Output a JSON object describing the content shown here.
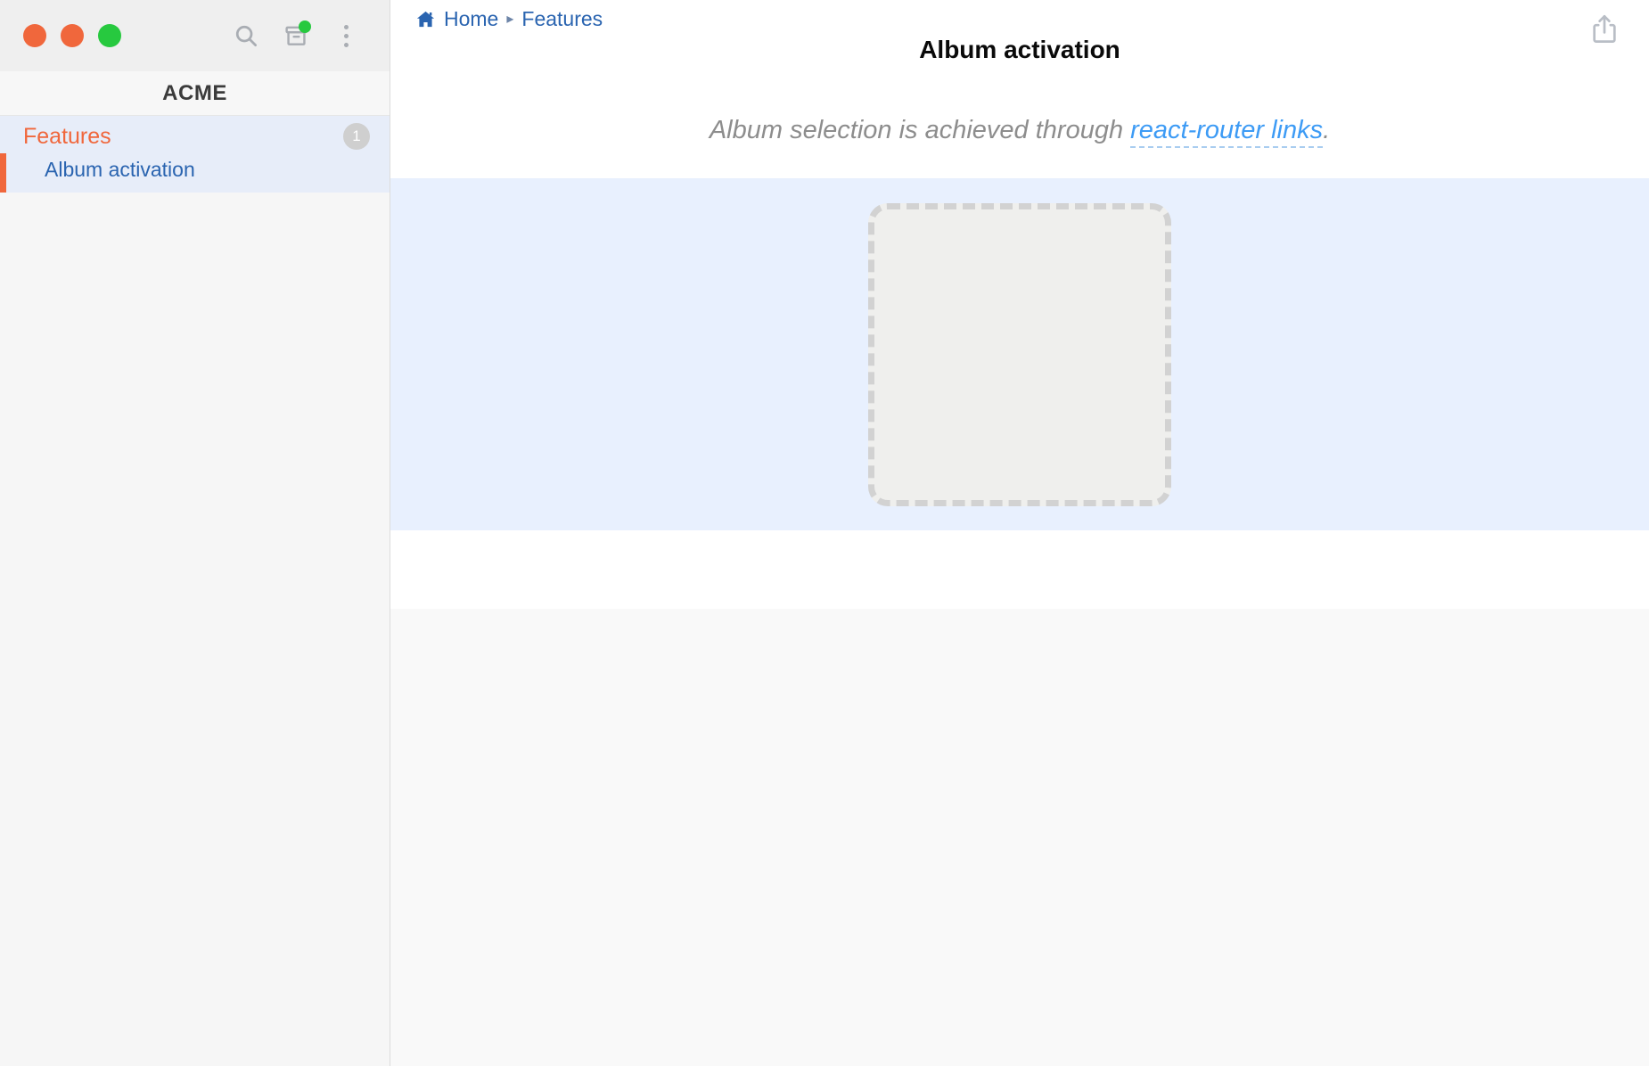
{
  "window": {
    "traffic_lights": [
      {
        "name": "close",
        "color": "#f0673c"
      },
      {
        "name": "minimize",
        "color": "#f0673c"
      },
      {
        "name": "zoom",
        "color": "#27c93f"
      }
    ],
    "toolbar_icons": [
      {
        "name": "search-icon",
        "label": "Search"
      },
      {
        "name": "archive-icon",
        "label": "Archive",
        "has_notification": true
      },
      {
        "name": "kebab-menu-icon",
        "label": "More options"
      }
    ]
  },
  "sidebar": {
    "brand": "ACME",
    "group": {
      "title": "Features",
      "badge": "1",
      "items": [
        {
          "label": "Album activation",
          "selected": true
        }
      ]
    }
  },
  "main": {
    "breadcrumb": {
      "home_icon": "home-icon",
      "home_label": "Home",
      "separator": "▸",
      "current": "Features"
    },
    "share_icon": "share-icon",
    "title": "Album activation",
    "lede": {
      "before": "Album selection is achieved through ",
      "link": "react-router links",
      "after": "."
    },
    "canvas": {
      "placeholder_name": "album-drop-placeholder",
      "background_color": "#e8f0fe",
      "placeholder_fill": "#efefed",
      "placeholder_border": "#d2d2d2"
    }
  },
  "colors": {
    "accent_orange": "#f0673c",
    "link_blue": "#2a64b0",
    "lede_link_blue": "#3d9bf5",
    "selected_row": "#e7edf9",
    "notification_green": "#27c93f"
  }
}
